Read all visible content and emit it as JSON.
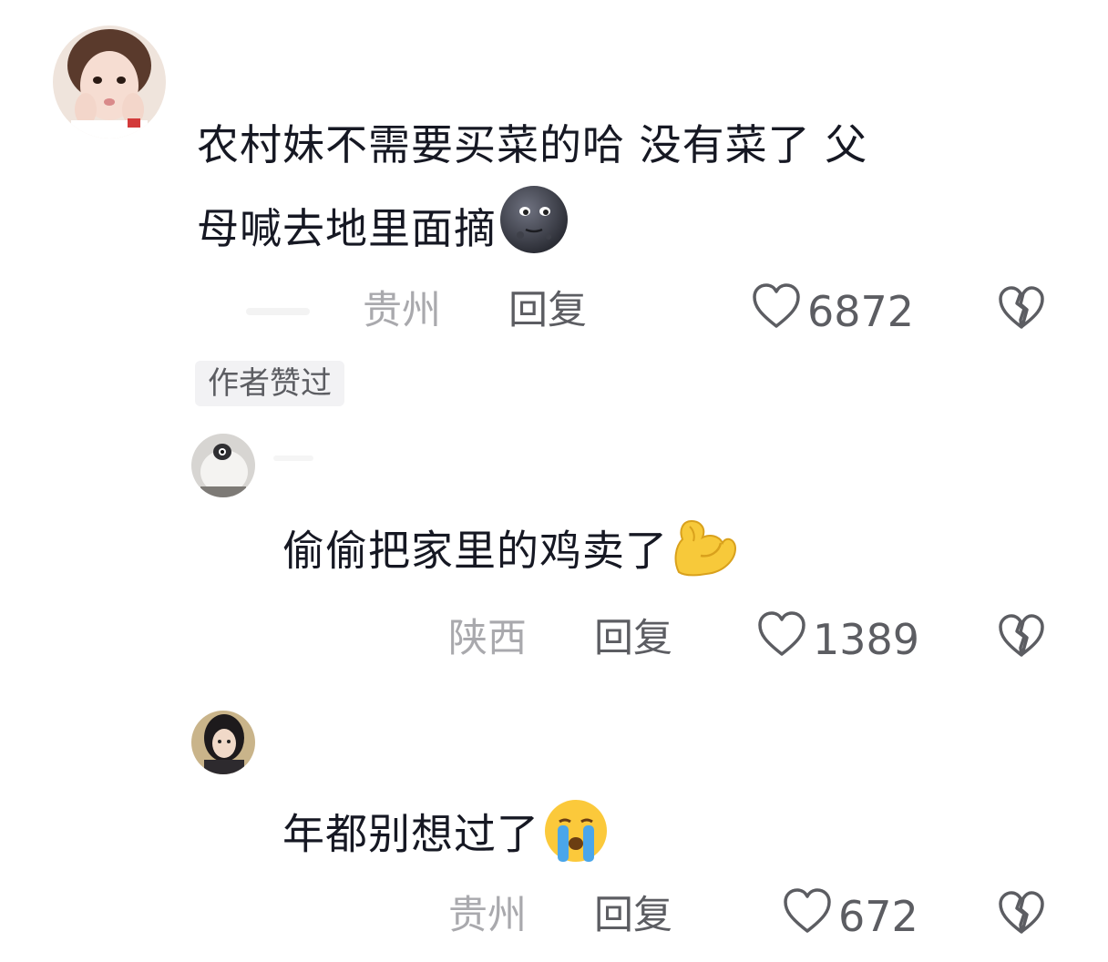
{
  "comments": [
    {
      "text_line1": "农村妹不需要买菜的哈 没有菜了 父",
      "text_line2": "母喊去地里面摘",
      "emoji": "new-moon-face-emoji",
      "location": "贵州",
      "reply_label": "回复",
      "likes": "6872",
      "badge": "作者赞过"
    },
    {
      "text": "偷偷把家里的鸡卖了",
      "emoji": "flexed-biceps-emoji",
      "location": "陕西",
      "reply_label": "回复",
      "likes": "1389"
    },
    {
      "text": "年都别想过了",
      "emoji": "loudly-crying-face-emoji",
      "location": "贵州",
      "reply_label": "回复",
      "likes": "672"
    }
  ],
  "icons": {
    "like": "heart-outline-icon",
    "dislike": "broken-heart-icon"
  },
  "colors": {
    "text_primary": "#161823",
    "text_secondary": "#5c5d62",
    "text_meta": "#a9a9ad",
    "badge_bg": "#f2f2f4"
  }
}
